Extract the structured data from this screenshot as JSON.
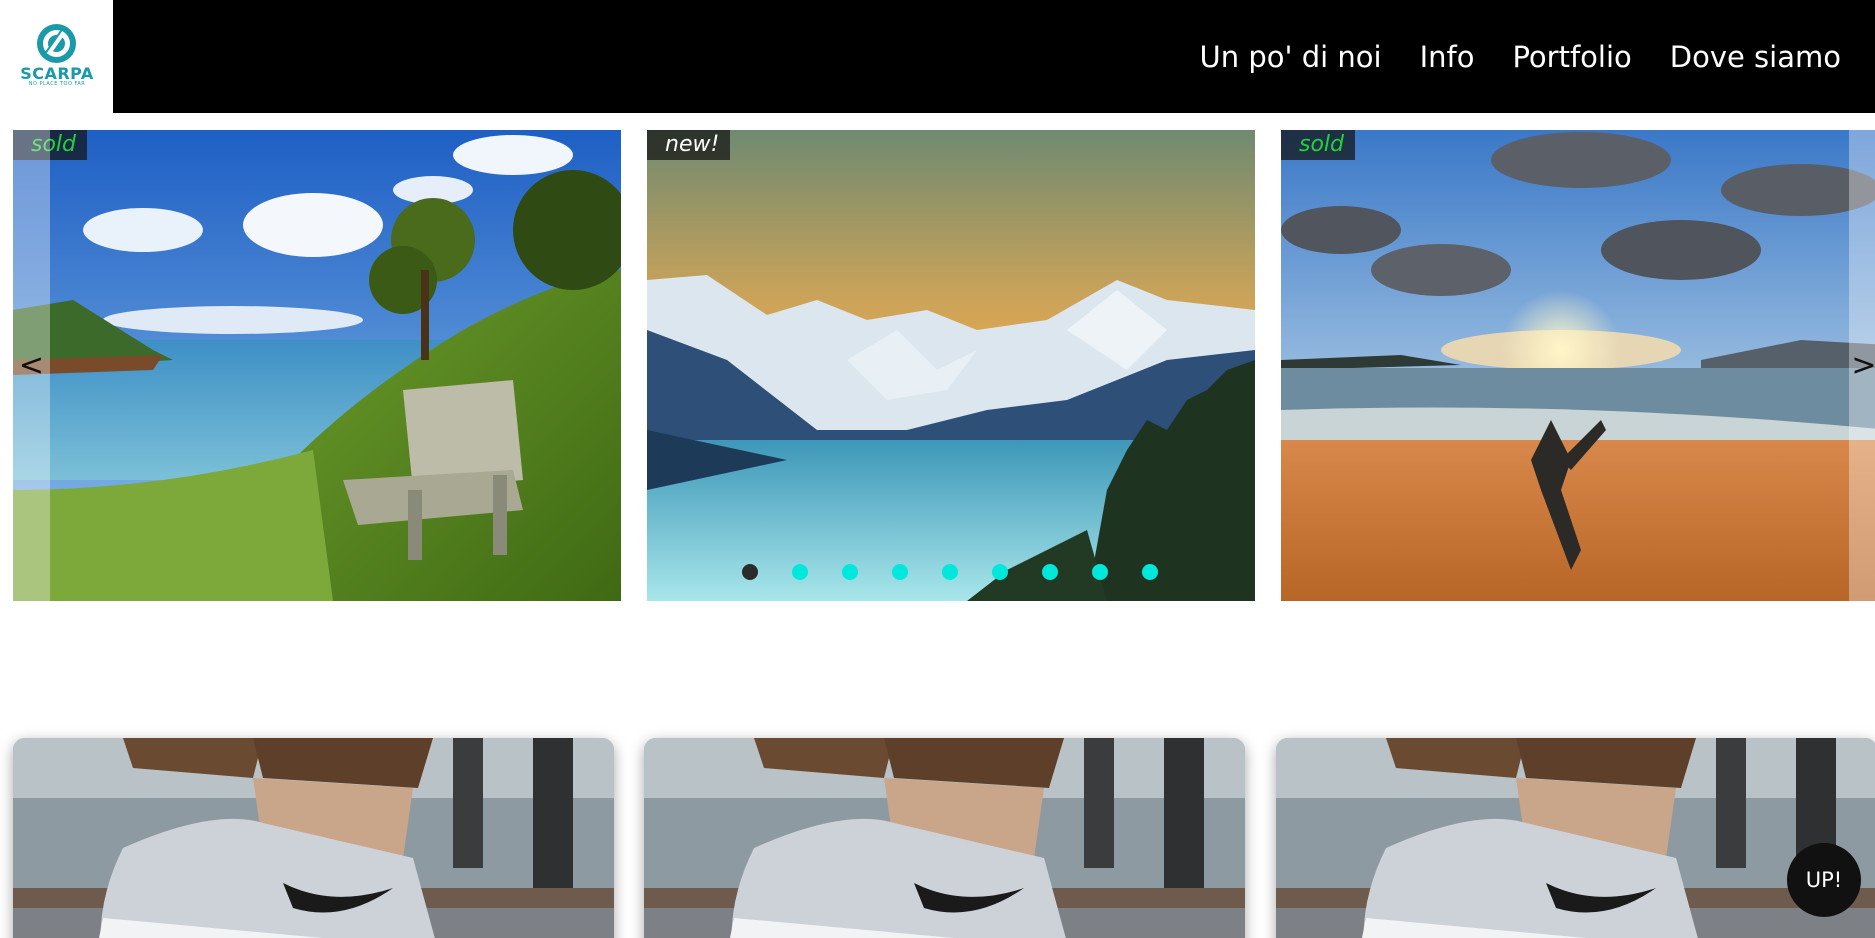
{
  "brand": {
    "name": "SCARPA",
    "tagline": "NO PLACE TOO FAR",
    "accent": "#1a9aa8",
    "logo_icon": "scarpa-logo-icon"
  },
  "nav": {
    "items": [
      "Un po' di noi",
      "Info",
      "Portfolio",
      "Dove siamo"
    ]
  },
  "carousel": {
    "prev_label": "<",
    "next_label": ">",
    "slides": [
      {
        "tag": "sold",
        "tag_color": "#22d23a",
        "scene": "coastal bench landscape"
      },
      {
        "tag": "new!",
        "tag_color": "#ffffff",
        "scene": "snowy mountains at sunset"
      },
      {
        "tag": "sold",
        "tag_color": "#22d23a",
        "scene": "beach sunset with driftwood"
      }
    ],
    "dot_count": 9,
    "active_dot": 0,
    "dot_color": "#00e8dc"
  },
  "cards": [
    {
      "scene": "sneaker photo"
    },
    {
      "scene": "sneaker photo"
    },
    {
      "scene": "sneaker photo"
    }
  ],
  "up_button": {
    "label": "UP!"
  }
}
